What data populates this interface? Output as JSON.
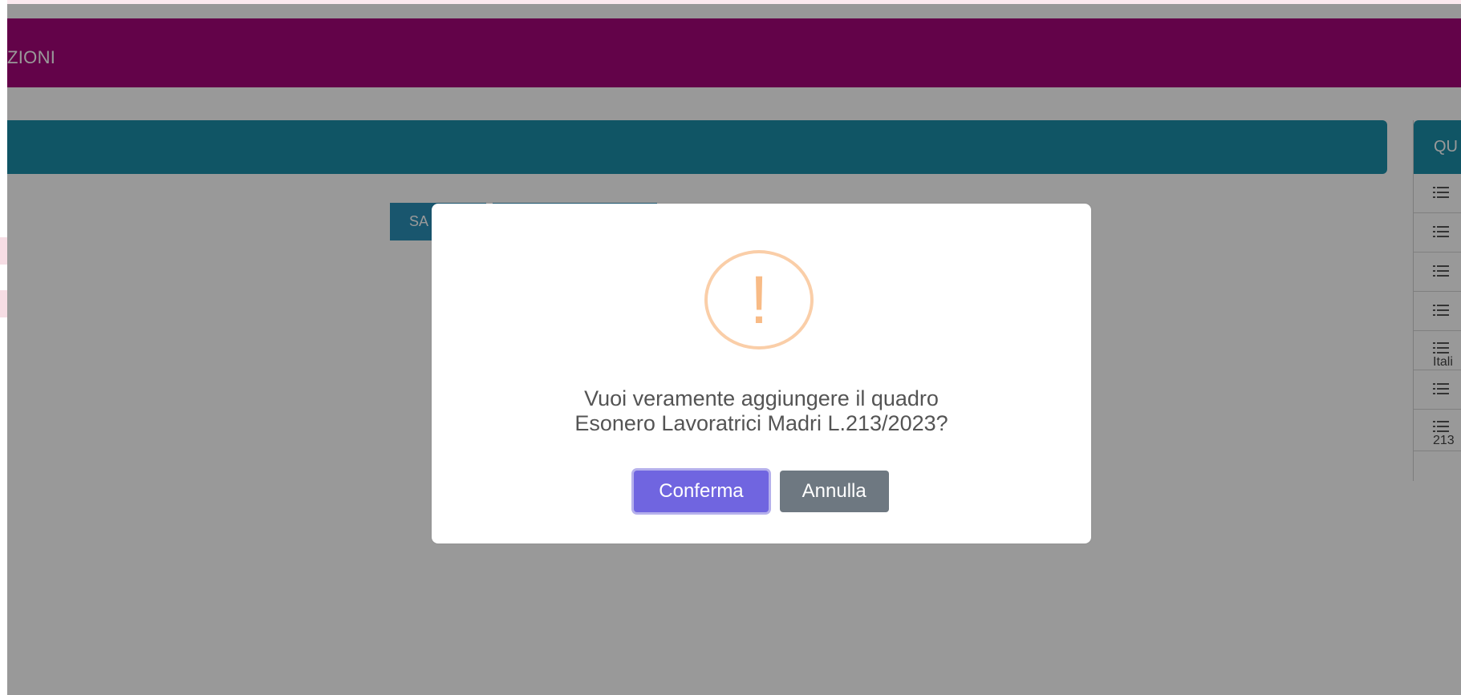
{
  "header": {
    "title": "ZIONI"
  },
  "toolbar": {
    "first_button_label": "SA"
  },
  "right_panel": {
    "heading": "QU",
    "items": [
      {
        "icon": "list-icon",
        "text": ""
      },
      {
        "icon": "list-icon",
        "text": ""
      },
      {
        "icon": "list-icon",
        "text": ""
      },
      {
        "icon": "list-icon",
        "text": ""
      },
      {
        "icon": "list-icon",
        "text": "Itali"
      },
      {
        "icon": "list-icon",
        "text": ""
      },
      {
        "icon": "list-icon",
        "text": "213"
      }
    ]
  },
  "dialog": {
    "icon": "warning-icon",
    "icon_glyph": "!",
    "message_line1": "Vuoi veramente aggiungere il quadro",
    "message_line2": "Esonero Lavoratrici Madri L.213/2023?",
    "confirm_label": "Conferma",
    "cancel_label": "Annulla"
  },
  "colors": {
    "header_bg": "#a5067a",
    "section_bg": "#1c8ea8",
    "confirm_bg": "#7065e0",
    "cancel_bg": "#6e7881",
    "warning": "#f8bb86"
  }
}
